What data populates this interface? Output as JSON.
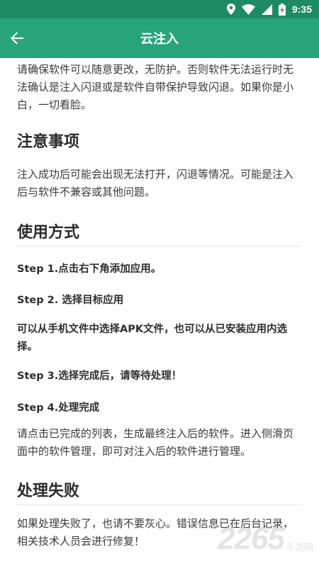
{
  "status_bar": {
    "time": "9:35",
    "icons": [
      "location-icon",
      "wifi-icon",
      "signal-icon",
      "battery-charging-icon"
    ]
  },
  "app_bar": {
    "title": "云注入",
    "back_icon": "arrow-left-icon"
  },
  "content": {
    "intro": "请确保软件可以随意更改，无防护。否则软件无法运行时无法确认是注入闪退或是软件自带保护导致闪退。如果你是小白，一切看脸。",
    "notes_heading": "注意事项",
    "notes_text": "注入成功后可能会出现无法打开，闪退等情况。可能是注入后与软件不兼容或其他问题。",
    "usage_heading": "使用方式",
    "step1": "Step 1.点击右下角添加应用。",
    "step2": "Step 2. 选择目标应用",
    "step2_detail": "可以从手机文件中选择APK文件，也可以从已安装应用内选择。",
    "step3": "Step 3.选择完成后，请等待处理！",
    "step4": "Step 4.处理完成",
    "steps_text": "请点击已完成的列表，生成最终注入后的软件。进入侧滑页面中的软件管理，即可对注入后的软件进行管理。",
    "fail_heading": "处理失败",
    "fail_text": "如果处理失败了，也请不要灰心。错误信息已在后台记录，相关技术人员会进行修复！"
  },
  "watermark": {
    "number": "2265",
    "text": "手游网"
  },
  "colors": {
    "status_bar": "#1e8a63",
    "app_bar": "#28a47a",
    "background": "#ffffff",
    "text": "#333333"
  }
}
